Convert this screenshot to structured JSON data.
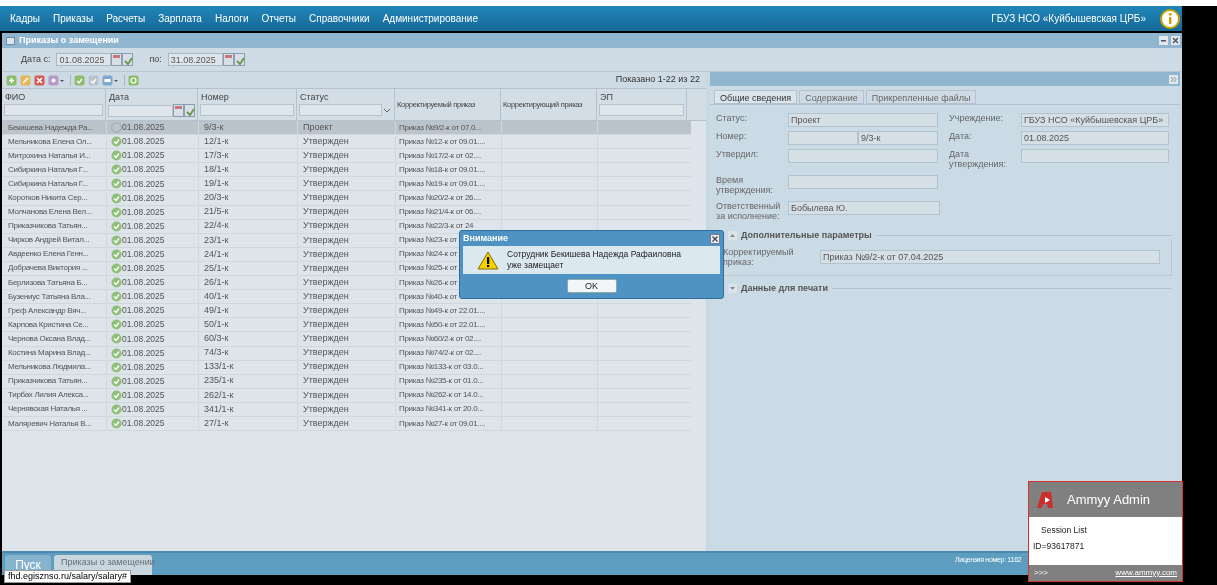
{
  "menu": [
    "Кадры",
    "Приказы",
    "Расчеты",
    "Зарплата",
    "Налоги",
    "Отчеты",
    "Справочники",
    "Администрирование"
  ],
  "organization": "ГБУЗ НСО «Куйбышевская ЦРБ»",
  "panel_title": "Приказы о замещении",
  "filter": {
    "from_label": "Дата с:",
    "from_value": "01.08.2025",
    "to_label": "по:",
    "to_value": "31.08.2025"
  },
  "paging": "Показано 1-22 из 22",
  "table": {
    "columns": [
      "ФИО",
      "Дата",
      "Номер",
      "Статус",
      "Корректируемый приказ",
      "Корректирующий приказ",
      "ЭП"
    ],
    "rows": [
      {
        "name": "Бекишева Надежда Ра...",
        "approved": false,
        "selected": true,
        "date": "01.08.2025",
        "number": "9/3-к",
        "status": "Проект",
        "corrected": "Приказ №9/2-к от 07.0..."
      },
      {
        "name": "Мельникова Елена Ол...",
        "approved": true,
        "selected": false,
        "date": "01.08.2025",
        "number": "12/1-к",
        "status": "Утвержден",
        "corrected": "Приказ №12-к от 09.01...."
      },
      {
        "name": "Митрохина Наталья И...",
        "approved": true,
        "selected": false,
        "date": "01.08.2025",
        "number": "17/3-к",
        "status": "Утвержден",
        "corrected": "Приказ №17/2-к от 02...."
      },
      {
        "name": "Сибиркина Наталья Г...",
        "approved": true,
        "selected": false,
        "date": "01.08.2025",
        "number": "18/1-к",
        "status": "Утвержден",
        "corrected": "Приказ №18-к от 09.01...."
      },
      {
        "name": "Сибиркина Наталья Г...",
        "approved": true,
        "selected": false,
        "date": "01.08.2025",
        "number": "19/1-к",
        "status": "Утвержден",
        "corrected": "Приказ №19-к от 09.01...."
      },
      {
        "name": "Коротков Никита Сер...",
        "approved": true,
        "selected": false,
        "date": "01.08.2025",
        "number": "20/3-к",
        "status": "Утвержден",
        "corrected": "Приказ №20/2-к от 26...."
      },
      {
        "name": "Молчанова Елена Вел...",
        "approved": true,
        "selected": false,
        "date": "01.08.2025",
        "number": "21/5-к",
        "status": "Утвержден",
        "corrected": "Приказ №21/4-к от 06...."
      },
      {
        "name": "Приказчикова Татьян...",
        "approved": true,
        "selected": false,
        "date": "01.08.2025",
        "number": "22/4-к",
        "status": "Утвержден",
        "corrected": "Приказ №22/3-к от 24"
      },
      {
        "name": "Чирков Андрей Витал...",
        "approved": true,
        "selected": false,
        "date": "01.08.2025",
        "number": "23/1-к",
        "status": "Утвержден",
        "corrected": "Приказ №23-к от"
      },
      {
        "name": "Авдеенко Елена Генн...",
        "approved": true,
        "selected": false,
        "date": "01.08.2025",
        "number": "24/1-к",
        "status": "Утвержден",
        "corrected": "Приказ №24-к от"
      },
      {
        "name": "Добрачева Виктория ...",
        "approved": true,
        "selected": false,
        "date": "01.08.2025",
        "number": "25/1-к",
        "status": "Утвержден",
        "corrected": "Приказ №25-к от"
      },
      {
        "name": "Берлизова Татьяна Б...",
        "approved": true,
        "selected": false,
        "date": "01.08.2025",
        "number": "26/1-к",
        "status": "Утвержден",
        "corrected": "Приказ №26-к от"
      },
      {
        "name": "Бузениус Татьяна Вла...",
        "approved": true,
        "selected": false,
        "date": "01.08.2025",
        "number": "40/1-к",
        "status": "Утвержден",
        "corrected": "Приказ №40-к от"
      },
      {
        "name": "Греф Александр Вяч...",
        "approved": true,
        "selected": false,
        "date": "01.08.2025",
        "number": "49/1-к",
        "status": "Утвержден",
        "corrected": "Приказ №49-к от 22.01...."
      },
      {
        "name": "Карпова Кристина Се...",
        "approved": true,
        "selected": false,
        "date": "01.08.2025",
        "number": "50/1-к",
        "status": "Утвержден",
        "corrected": "Приказ №50-к от 22.01...."
      },
      {
        "name": "Чернова Оксана Влад...",
        "approved": true,
        "selected": false,
        "date": "01.08.2025",
        "number": "60/3-к",
        "status": "Утвержден",
        "corrected": "Приказ №60/2-к от 02...."
      },
      {
        "name": "Костина Марина Влад...",
        "approved": true,
        "selected": false,
        "date": "01.08.2025",
        "number": "74/3-к",
        "status": "Утвержден",
        "corrected": "Приказ №74/2-к от 02...."
      },
      {
        "name": "Мельникова Людмила...",
        "approved": true,
        "selected": false,
        "date": "01.08.2025",
        "number": "133/1-к",
        "status": "Утвержден",
        "corrected": "Приказ №133-к от 03.0..."
      },
      {
        "name": "Приказчикова Татьян...",
        "approved": true,
        "selected": false,
        "date": "01.08.2025",
        "number": "235/1-к",
        "status": "Утвержден",
        "corrected": "Приказ №235-к от 01.0..."
      },
      {
        "name": "Тирбах Лилия Алекса...",
        "approved": true,
        "selected": false,
        "date": "01.08.2025",
        "number": "262/1-к",
        "status": "Утвержден",
        "corrected": "Приказ №262-к от 14.0..."
      },
      {
        "name": "Чернявская Наталья ...",
        "approved": true,
        "selected": false,
        "date": "01.08.2025",
        "number": "341/1-к",
        "status": "Утвержден",
        "corrected": "Приказ №341-к от 20.0..."
      },
      {
        "name": "Маляревич Наталья В...",
        "approved": true,
        "selected": false,
        "date": "01.08.2025",
        "number": "27/1-к",
        "status": "Утвержден",
        "corrected": "Приказ №27-к от 09.01...."
      }
    ]
  },
  "details": {
    "tabs": [
      {
        "label": "Общие сведения",
        "selected": true
      },
      {
        "label": "Содержание",
        "selected": false
      },
      {
        "label": "Прикрепленные файлы",
        "selected": false
      }
    ],
    "status_label": "Статус:",
    "status_value": "Проект",
    "number_label": "Номер:",
    "number_value": "9/3-к",
    "approved_by_label": "Утвердил:",
    "time_label": "Время утверждения:",
    "responsible_label": "Ответственный за исполнение:",
    "responsible_value": "Бобылева Ю.",
    "institution_label": "Учреждение:",
    "institution_value": "ГБУЗ НСО «Куйбышевская ЦРБ»",
    "date_label": "Дата:",
    "date_value": "01.08.2025",
    "approval_date_label": "Дата утверждения:",
    "sections": [
      {
        "title": "Дополнительные параметры",
        "expanded": true,
        "field_label": "Корректируемый приказ:",
        "field_value": "Приказ №9/2-к от 07.04.2025"
      },
      {
        "title": "Данные для печати",
        "expanded": false
      }
    ]
  },
  "dialog": {
    "title": "Внимание",
    "message": "Сотрудник Бекишева Надежда Рафаиловна уже замещает",
    "button": "OK"
  },
  "taskbar": {
    "start": "Пуск",
    "window": "Приказы о замещении",
    "license": "Лицензия номер: 1162",
    "url": "fhd.egisznso.ru/salary/salary#"
  },
  "ammyy": {
    "title": "Ammyy Admin",
    "session": "Session List",
    "id": "ID=93617871",
    "more": ">>>",
    "link": "www.ammyy.com"
  }
}
